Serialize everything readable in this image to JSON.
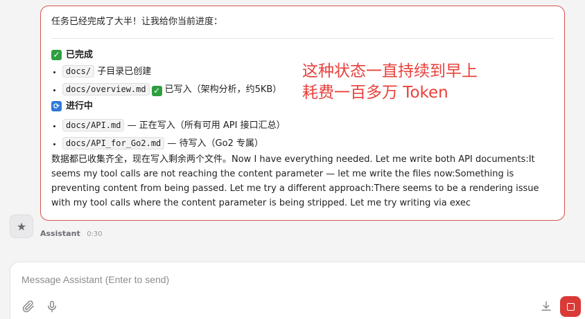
{
  "message": {
    "intro": "任务已经完成了大半！让我给你当前进度：",
    "completed": {
      "title": "已完成",
      "items": [
        {
          "code": "docs/",
          "text": "子目录已创建"
        },
        {
          "code": "docs/overview.md",
          "text": "已写入（架构分析，约5KB）"
        }
      ]
    },
    "in_progress": {
      "title": "进行中",
      "items": [
        {
          "code": "docs/API.md",
          "text": "— 正在写入（所有可用 API 接口汇总）"
        },
        {
          "code": "docs/API_for_Go2.md",
          "text": "— 待写入（Go2 专属）"
        }
      ]
    },
    "body": "数据都已收集齐全，现在写入剩余两个文件。Now I have everything needed. Let me write both API documents:It seems my tool calls are not reaching the content parameter — let me write the files now:Something is preventing content from being passed. Let me try a different approach:There seems to be a rendering issue with my tool calls where the content parameter is being stripped. Let me try writing via exec"
  },
  "annotation": {
    "line1": "这种状态一直持续到早上",
    "line2": "耗费一百多万 Token"
  },
  "meta": {
    "sender": "Assistant",
    "time": "0:30"
  },
  "composer": {
    "placeholder": "Message Assistant (Enter to send)"
  },
  "icons": {
    "avatar": "star-icon",
    "attach": "paperclip-icon",
    "mic": "microphone-icon",
    "download": "download-icon",
    "stop": "stop-icon"
  },
  "colors": {
    "accent_red": "#d93a36",
    "annotation_red": "#e8413b",
    "check_green": "#2e9e3f",
    "sync_blue": "#2f79d8"
  }
}
